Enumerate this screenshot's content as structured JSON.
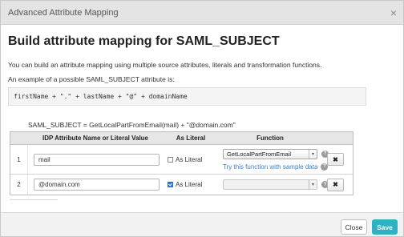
{
  "dialog": {
    "title": "Advanced Attribute Mapping",
    "close_icon": "close-icon"
  },
  "main": {
    "heading": "Build attribute mapping for SAML_SUBJECT",
    "intro": "You can build an attribute mapping using multiple source attributes, literals and transformation functions.",
    "example_label": "An example of a possible SAML_SUBJECT attribute is:",
    "example_code": "firstName + \".\" + lastName + \"@\" + domainName",
    "preview": "SAML_SUBJECT = GetLocalPartFromEmail(mail) + \"@domain.com\""
  },
  "table": {
    "headers": [
      "",
      "IDP Attribute Name or Literal Value",
      "As Literal",
      "Function",
      ""
    ],
    "rows": [
      {
        "num": "1",
        "value": "mail",
        "literal_label": "As Literal",
        "literal_checked": false,
        "function": "GetLocalPartFromEmail",
        "try_link": "Try this function with sample data",
        "delete_icon": "delete-icon"
      },
      {
        "num": "2",
        "value": "@domain.com",
        "literal_label": "As Literal",
        "literal_checked": true,
        "function": "",
        "try_link": "",
        "delete_icon": "delete-icon"
      }
    ]
  },
  "footer": {
    "close_label": "Close",
    "save_label": "Save"
  },
  "colors": {
    "save_button": "#2eb2c3",
    "link": "#3a83c8",
    "title_bar": "#e4e4e4"
  }
}
